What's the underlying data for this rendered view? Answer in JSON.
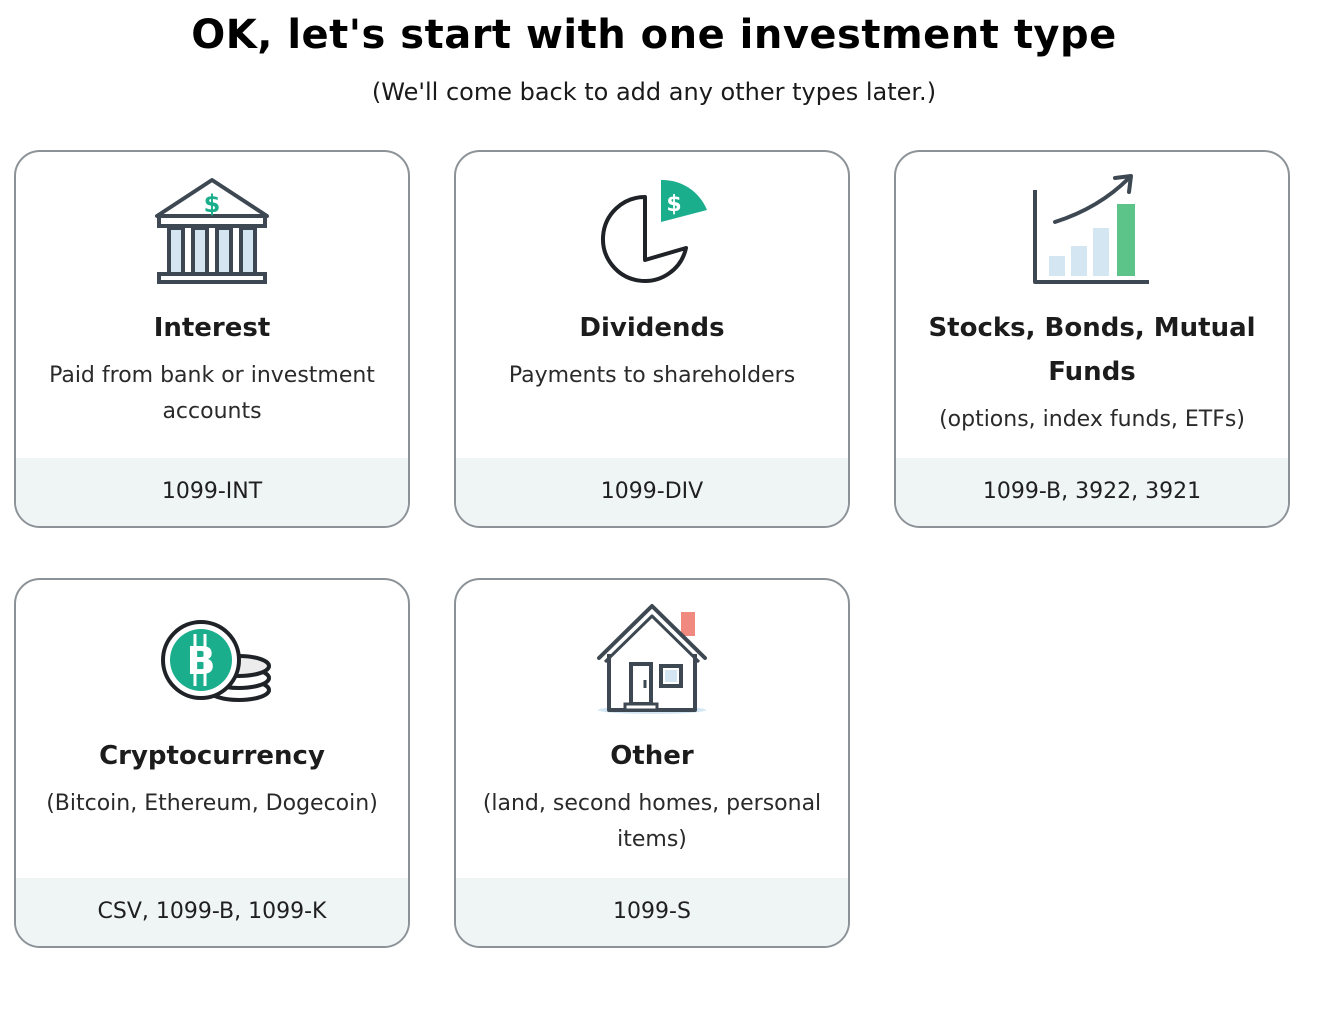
{
  "header": {
    "title": "OK, let's start with one investment type",
    "subtitle": "(We'll come back to add any other types later.)"
  },
  "cards": [
    {
      "title": "Interest",
      "description": "Paid from bank or investment accounts",
      "forms": "1099-INT",
      "icon": "bank-icon"
    },
    {
      "title": "Dividends",
      "description": "Payments to shareholders",
      "forms": "1099-DIV",
      "icon": "pie-chart-dollar-icon"
    },
    {
      "title": "Stocks, Bonds, Mutual Funds",
      "description": "(options, index funds, ETFs)",
      "forms": "1099-B, 3922, 3921",
      "icon": "growth-chart-icon"
    },
    {
      "title": "Cryptocurrency",
      "description": "(Bitcoin, Ethereum, Dogecoin)",
      "forms": "CSV, 1099-B, 1099-K",
      "icon": "bitcoin-coins-icon"
    },
    {
      "title": "Other",
      "description": "(land, second homes, personal items)",
      "forms": "1099-S",
      "icon": "house-icon"
    }
  ],
  "colors": {
    "accent_green": "#1aae8c",
    "bar_green": "#5cc488",
    "light_blue": "#d4e6f2",
    "outline": "#3d4852",
    "chimney_red": "#f08a80",
    "card_border": "#8c9398",
    "footer_bg": "#eff4f5"
  }
}
